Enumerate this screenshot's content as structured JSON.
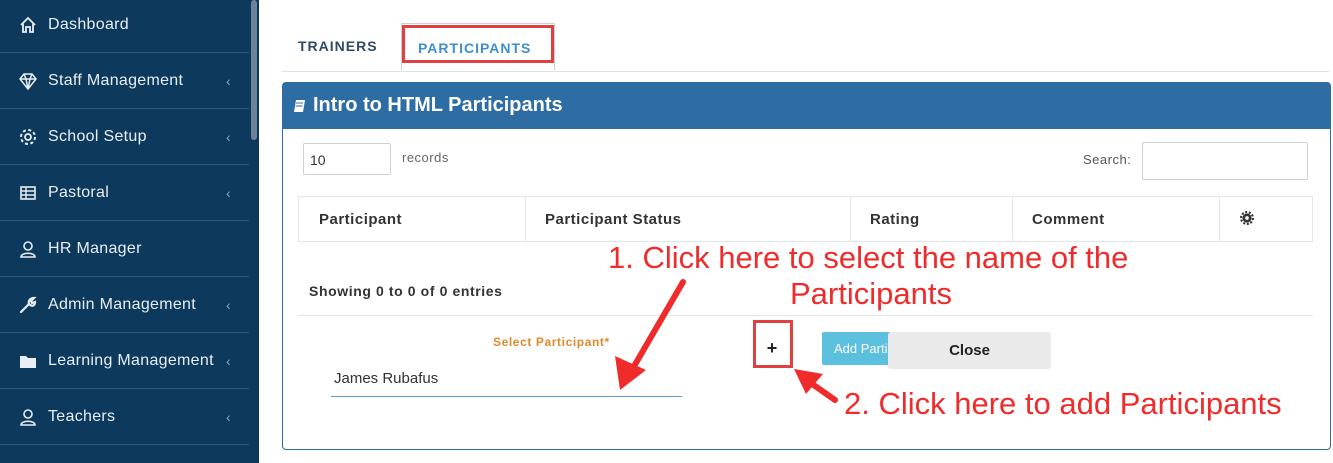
{
  "sidebar": {
    "items": [
      {
        "label": "Dashboard",
        "icon": "home-icon",
        "has_chevron": false
      },
      {
        "label": "Staff Management",
        "icon": "diamond-icon",
        "has_chevron": true
      },
      {
        "label": "School Setup",
        "icon": "gear-icon",
        "has_chevron": true
      },
      {
        "label": "Pastoral",
        "icon": "table-icon",
        "has_chevron": true
      },
      {
        "label": "HR Manager",
        "icon": "user-icon",
        "has_chevron": false
      },
      {
        "label": "Admin Management",
        "icon": "wrench-icon",
        "has_chevron": true
      },
      {
        "label": "Learning Management",
        "icon": "folder-icon",
        "has_chevron": true
      },
      {
        "label": "Teachers",
        "icon": "user-icon",
        "has_chevron": true
      }
    ],
    "chevron": "‹"
  },
  "tabs": [
    {
      "label": "TRAINERS",
      "active": false
    },
    {
      "label": "PARTICIPANTS",
      "active": true
    }
  ],
  "panel": {
    "title": "Intro to HTML Participants",
    "icon": "book-icon",
    "length_value": "10",
    "length_label": "records",
    "search_label": "Search:",
    "columns": [
      "Participant",
      "Participant Status",
      "Rating",
      "Comment"
    ],
    "settings_icon": "gear-icon",
    "info": "Showing 0 to 0 of 0 entries",
    "select_label": "Select Participant*",
    "select_value": "James Rubafus",
    "plus_label": "+",
    "add_label": "Add Participant",
    "close_label": "Close"
  },
  "annotations": {
    "step1_line1": "1. Click here to select the name of the",
    "step1_line2": "Participants",
    "step2": "2. Click here to add Participants"
  },
  "colors": {
    "sidebar_bg": "#0d3a5c",
    "panel_header": "#2e6ca4",
    "annotation_red": "#ef2b2b",
    "active_tab": "#3d8fcf",
    "select_label": "#e08a2c",
    "add_button": "#5bc0de"
  }
}
